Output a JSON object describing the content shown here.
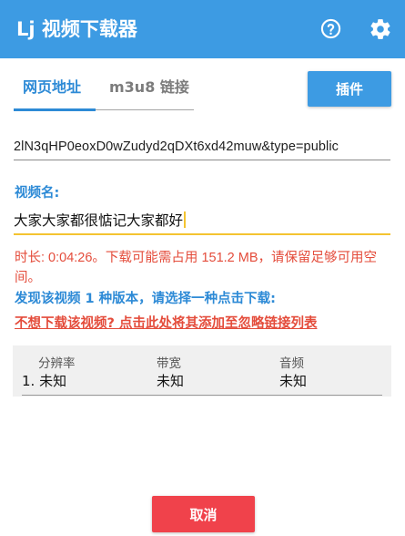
{
  "appbar": {
    "title": "Lj 视频下载器",
    "help_icon": "help-circle-icon",
    "settings_icon": "gear-icon",
    "color": "#3d9be3"
  },
  "tabs": {
    "items": [
      {
        "label": "网页地址",
        "active": true
      },
      {
        "label": "m3u8 链接",
        "active": false
      }
    ]
  },
  "plugin_button": {
    "label": "插件"
  },
  "url_field": {
    "value": "2lN3qHP0eoxD0wZudyd2qDXt6xd42muw&type=public"
  },
  "video_name": {
    "label": "视频名:",
    "value": "大家大家都很惦记大家都好"
  },
  "info": {
    "duration_text": "时长: 0:04:26。下载可能需占用 151.2 MB，请保留足够可用空间。",
    "found_text": "发现该视频 1 种版本，请选择一种点击下载:",
    "ignore_link": "不想下载该视频? 点击此处将其添加至忽略链接列表"
  },
  "versions_table": {
    "headers": [
      "分辨率",
      "带宽",
      "音频"
    ],
    "rows": [
      [
        "1. 未知",
        "未知",
        "未知"
      ]
    ]
  },
  "cancel_button": {
    "label": "取消",
    "color": "#f0424b"
  },
  "colors": {
    "accent": "#2d8ad6",
    "warning": "#e44c3b",
    "input_focus": "#f4c430"
  }
}
